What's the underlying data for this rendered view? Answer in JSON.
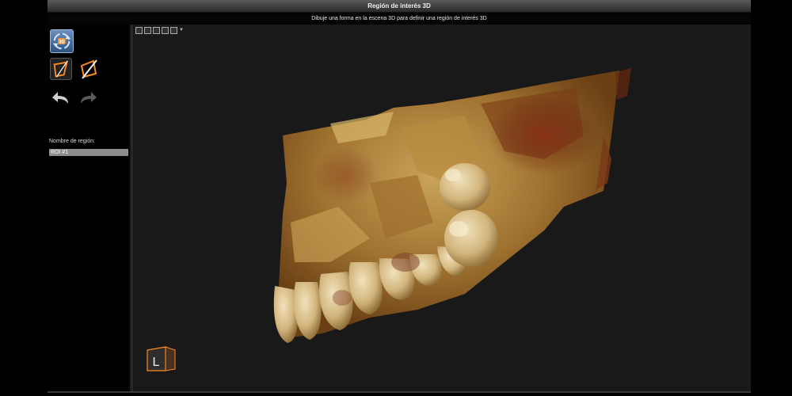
{
  "window": {
    "title": "Región de interés 3D",
    "instruction": "Dibuje una forma en la escena 3D para definir una región de interés 3D"
  },
  "tools": {
    "view3d_label": "3D",
    "orientation_label": "L"
  },
  "region": {
    "name_label": "Nombre de región:",
    "name_value": "ROI #1"
  },
  "colors": {
    "accent": "#ff8a1f",
    "panel_bg": "#000000",
    "viewport_bg": "#1a1919",
    "bone_light": "#d8c48f",
    "bone_dark": "#8a5a20"
  }
}
